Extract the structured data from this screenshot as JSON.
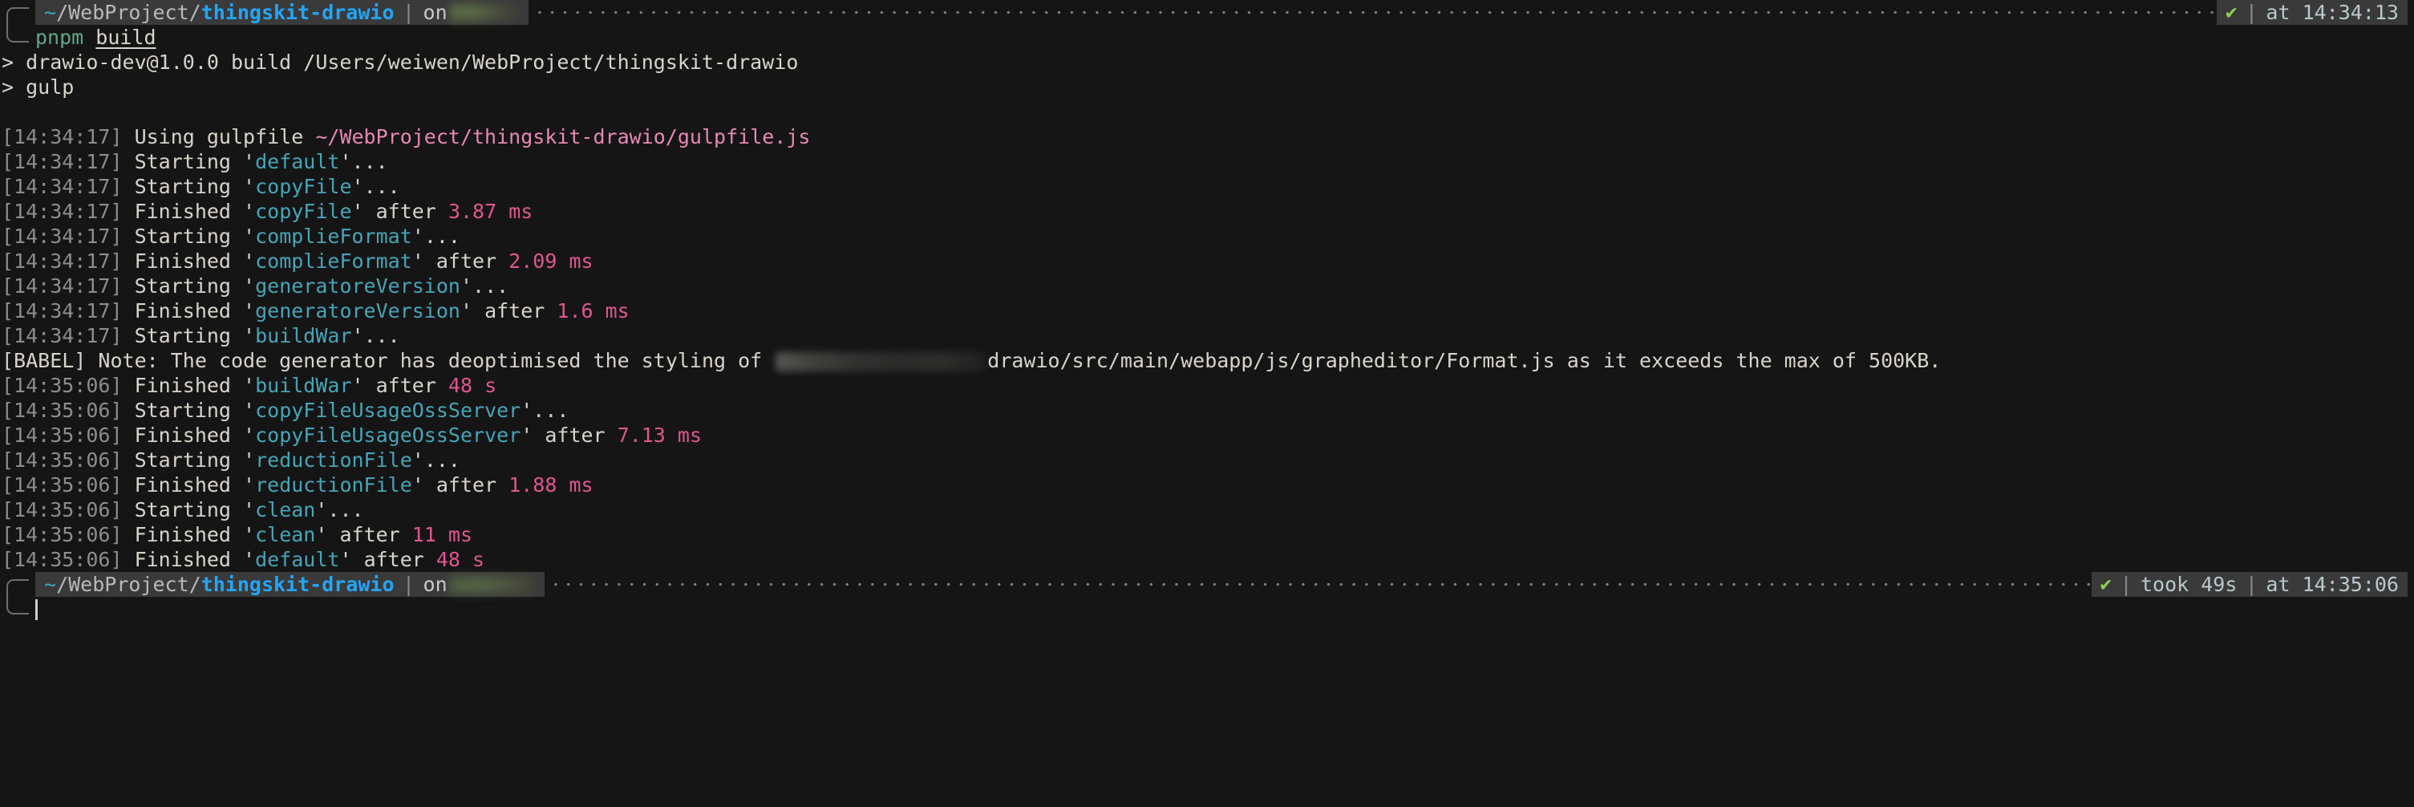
{
  "terminal": {
    "background_color": "#151515",
    "foreground_color": "#d8d4cc",
    "segment_bg_color": "#3a3a3a"
  },
  "prompt_top": {
    "tilde": "~",
    "path_prefix": "/WebProject/",
    "path_project": "thingskit-drawio",
    "on_label": "on",
    "branch": "",
    "status_icon": "✔",
    "at_label": "at",
    "time": "14:34:13",
    "divider": "|"
  },
  "command": {
    "name": "pnpm",
    "arg": "build"
  },
  "output_lines": [
    {
      "type": "plain",
      "text": "> drawio-dev@1.0.0 build /Users/weiwen/WebProject/thingskit-drawio"
    },
    {
      "type": "plain",
      "text": "> gulp"
    },
    {
      "type": "blank",
      "text": ""
    },
    {
      "type": "gulpfile",
      "timestamp": "[14:34:17]",
      "label": " Using gulpfile ",
      "path": "~/WebProject/thingskit-drawio/gulpfile.js"
    },
    {
      "type": "starting",
      "timestamp": "[14:34:17]",
      "label": " Starting ",
      "task": "default",
      "suffix": "..."
    },
    {
      "type": "starting",
      "timestamp": "[14:34:17]",
      "label": " Starting ",
      "task": "copyFile",
      "suffix": "..."
    },
    {
      "type": "finished",
      "timestamp": "[14:34:17]",
      "label": " Finished ",
      "task": "copyFile",
      "after": " after ",
      "duration": "3.87 ms"
    },
    {
      "type": "starting",
      "timestamp": "[14:34:17]",
      "label": " Starting ",
      "task": "complieFormat",
      "suffix": "..."
    },
    {
      "type": "finished",
      "timestamp": "[14:34:17]",
      "label": " Finished ",
      "task": "complieFormat",
      "after": " after ",
      "duration": "2.09 ms"
    },
    {
      "type": "starting",
      "timestamp": "[14:34:17]",
      "label": " Starting ",
      "task": "generatoreVersion",
      "suffix": "..."
    },
    {
      "type": "finished",
      "timestamp": "[14:34:17]",
      "label": " Finished ",
      "task": "generatoreVersion",
      "after": " after ",
      "duration": "1.6 ms"
    },
    {
      "type": "starting",
      "timestamp": "[14:34:17]",
      "label": " Starting ",
      "task": "buildWar",
      "suffix": "..."
    },
    {
      "type": "babel",
      "prefix": "[BABEL] Note: The code generator has deoptimised the styling of ",
      "redacted": "",
      "suffix": "drawio/src/main/webapp/js/grapheditor/Format.js as it exceeds the max of 500KB."
    },
    {
      "type": "finished",
      "timestamp": "[14:35:06]",
      "label": " Finished ",
      "task": "buildWar",
      "after": " after ",
      "duration": "48 s"
    },
    {
      "type": "starting",
      "timestamp": "[14:35:06]",
      "label": " Starting ",
      "task": "copyFileUsageOssServer",
      "suffix": "..."
    },
    {
      "type": "finished",
      "timestamp": "[14:35:06]",
      "label": " Finished ",
      "task": "copyFileUsageOssServer",
      "after": " after ",
      "duration": "7.13 ms"
    },
    {
      "type": "starting",
      "timestamp": "[14:35:06]",
      "label": " Starting ",
      "task": "reductionFile",
      "suffix": "..."
    },
    {
      "type": "finished",
      "timestamp": "[14:35:06]",
      "label": " Finished ",
      "task": "reductionFile",
      "after": " after ",
      "duration": "1.88 ms"
    },
    {
      "type": "starting",
      "timestamp": "[14:35:06]",
      "label": " Starting ",
      "task": "clean",
      "suffix": "..."
    },
    {
      "type": "finished",
      "timestamp": "[14:35:06]",
      "label": " Finished ",
      "task": "clean",
      "after": " after ",
      "duration": "11 ms"
    },
    {
      "type": "finished",
      "timestamp": "[14:35:06]",
      "label": " Finished ",
      "task": "default",
      "after": " after ",
      "duration": "48 s"
    }
  ],
  "prompt_bottom": {
    "tilde": "~",
    "path_prefix": "/WebProject/",
    "path_project": "thingskit-drawio",
    "on_label": "on",
    "branch": "",
    "status_icon": "✔",
    "took_label": "took 49s",
    "at_label": "at",
    "time": "14:35:06",
    "divider": "|"
  },
  "colors": {
    "task_cyan": "#45a5b8",
    "duration_pink": "#e0568f",
    "path_pink": "#e887b4",
    "project_blue": "#24a5f7",
    "check_green": "#8fd14f",
    "timestamp_gray": "#8d8d8d"
  }
}
